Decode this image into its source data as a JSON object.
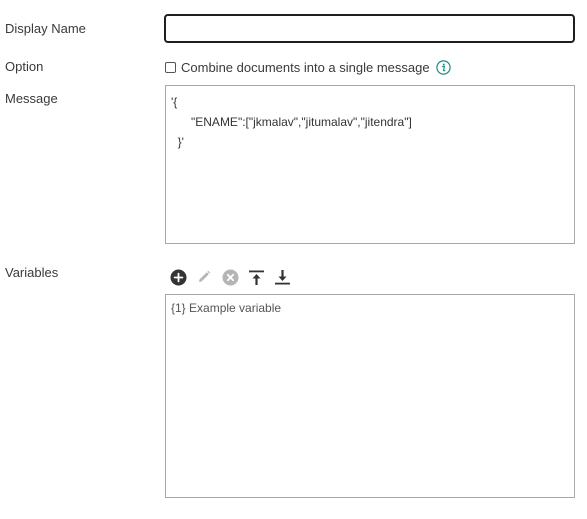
{
  "form": {
    "display_name": {
      "label": "Display Name",
      "value": ""
    },
    "option": {
      "label": "Option",
      "checkbox_label": "Combine documents into a single message",
      "checked": false
    },
    "message": {
      "label": "Message",
      "value": "'{\n      \"ENAME\":[\"jkmalav\",\"jitumalav\",\"jitendra\"]\n  }'"
    },
    "variables": {
      "label": "Variables",
      "toolbar": [
        "add-icon",
        "edit-icon",
        "delete-icon",
        "move-to-top-icon",
        "move-to-bottom-icon"
      ],
      "items": [
        "{1} Example variable"
      ]
    }
  },
  "colors": {
    "info": "#1e8a8a",
    "icon_active": "#333333",
    "icon_disabled": "#b5b5b5",
    "border": "#a8a8a8"
  }
}
